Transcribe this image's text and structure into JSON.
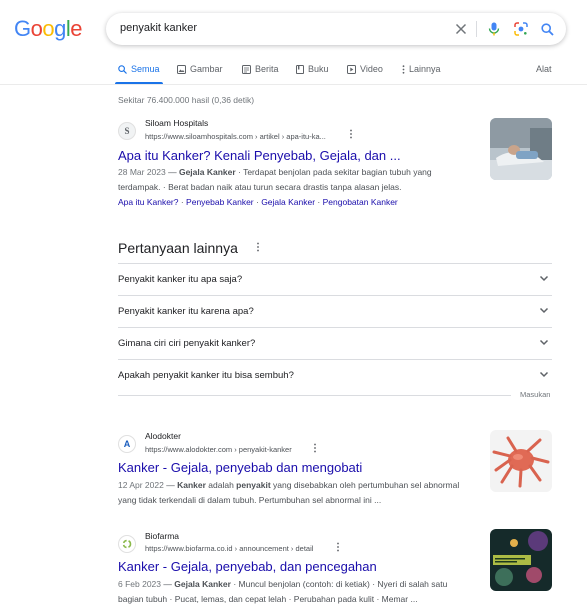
{
  "logo": {
    "text": "Google",
    "letters": [
      "G",
      "o",
      "o",
      "g",
      "l",
      "e"
    ],
    "colors": [
      "#4285f4",
      "#ea4335",
      "#fbbc05",
      "#4285f4",
      "#34a853",
      "#ea4335"
    ]
  },
  "search": {
    "query": "penyakit kanker"
  },
  "icons": {
    "clear": "close-icon",
    "voice": "mic-icon",
    "lens": "lens-icon",
    "search": "search-icon"
  },
  "tabs": [
    {
      "label": "Semua",
      "icon": "search-icon",
      "active": true
    },
    {
      "label": "Gambar",
      "icon": "image-icon"
    },
    {
      "label": "Berita",
      "icon": "news-icon"
    },
    {
      "label": "Buku",
      "icon": "book-icon"
    },
    {
      "label": "Video",
      "icon": "video-icon"
    },
    {
      "label": "Lainnya",
      "icon": "more-vert-icon"
    }
  ],
  "tools": "Alat",
  "stats": "Sekitar 76.400.000 hasil (0,36 detik)",
  "results": [
    {
      "site": "Siloam Hospitals",
      "url": "https://www.siloamhospitals.com › artikel › apa-itu-ka...",
      "favicon": "S",
      "title": "Apa itu Kanker? Kenali Penyebab, Gejala, dan ...",
      "date": "28 Mar 2023",
      "dash": " — ",
      "bold": "Gejala Kanker",
      "snippet_a": " · Terdapat benjolan pada sekitar bagian tubuh yang terdampak. · Berat badan naik atau turun secara drastis tanpa alasan jelas.",
      "links": [
        "Apa itu Kanker?",
        "Penyebab Kanker",
        "Gejala Kanker",
        "Pengobatan Kanker"
      ]
    },
    {
      "site": "Alodokter",
      "url": "https://www.alodokter.com › penyakit-kanker",
      "favicon": "A",
      "title": "Kanker - Gejala, penyebab dan mengobati",
      "date": "12 Apr 2022",
      "dash": " — ",
      "bold": "Kanker",
      "snippet_a": " adalah ",
      "bold2": "penyakit",
      "snippet_b": " yang disebabkan oleh pertumbuhan sel abnormal yang tidak terkendali di dalam tubuh. Pertumbuhan sel abnormal ini ..."
    },
    {
      "site": "Biofarma",
      "url": "https://www.biofarma.co.id › announcement › detail",
      "favicon": "B",
      "title": "Kanker - Gejala, penyebab, dan pencegahan",
      "date": "6 Feb 2023",
      "dash": " — ",
      "bold": "Gejala Kanker",
      "snippet_a": " · Muncul benjolan (contoh: di ketiak) · Nyeri di salah satu bagian tubuh · Pucat, lemas, dan cepat lelah · Perubahan pada kulit · Memar ..."
    }
  ],
  "paa": {
    "title": "Pertanyaan lainnya",
    "questions": [
      "Penyakit kanker itu apa saja?",
      "Penyakit kanker itu karena apa?",
      "Gimana ciri ciri penyakit kanker?",
      "Apakah penyakit kanker itu bisa sembuh?"
    ],
    "feedback": "Masukan"
  },
  "colors": {
    "link": "#1a0dab",
    "accent": "#1a73e8",
    "muted": "#4d5156"
  }
}
